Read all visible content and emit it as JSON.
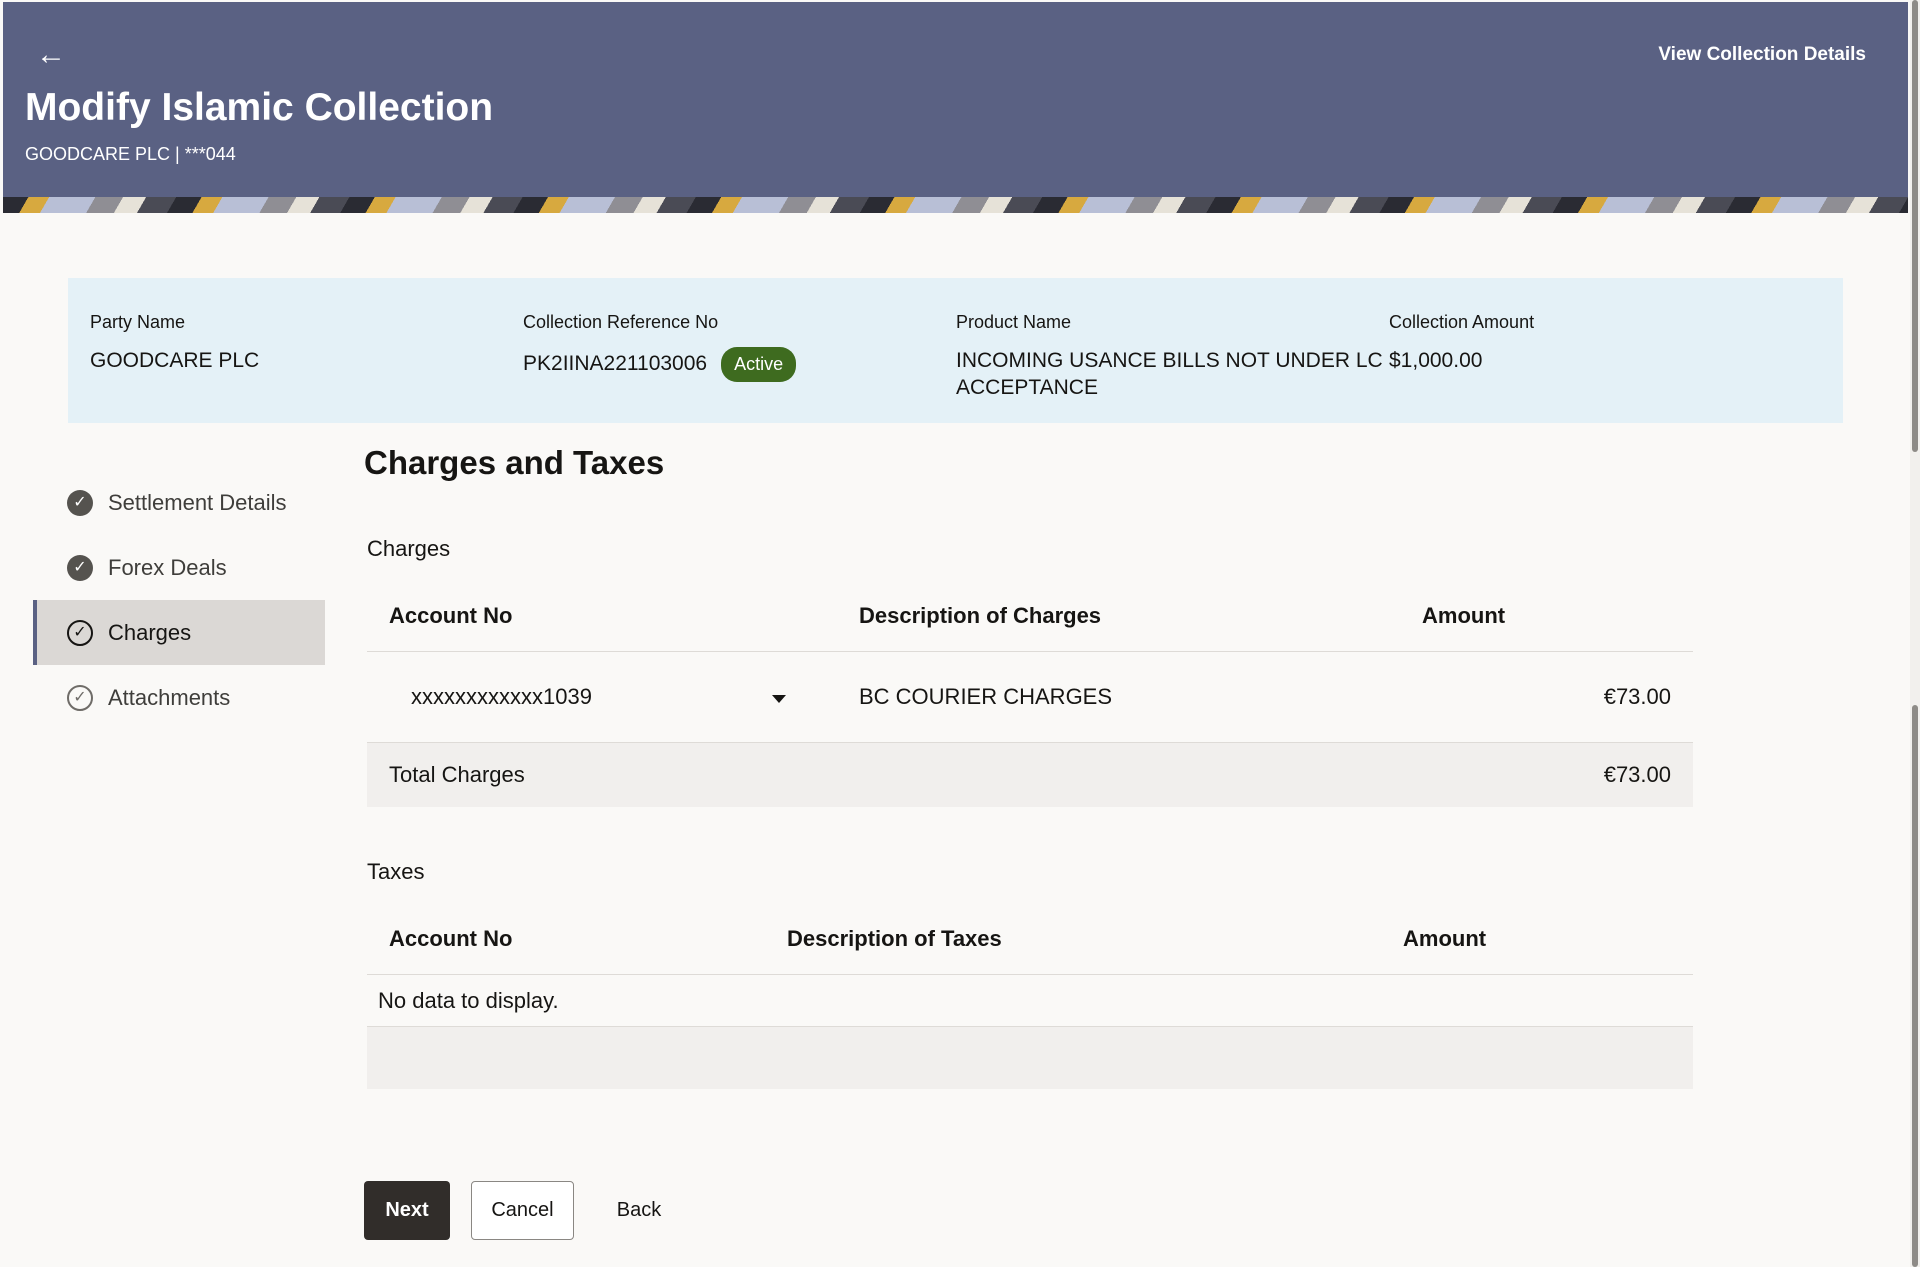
{
  "header": {
    "title": "Modify Islamic Collection",
    "subtitle": "GOODCARE PLC | ***044",
    "back_icon": "←",
    "view_link": "View Collection Details"
  },
  "summary": {
    "party_name_label": "Party Name",
    "party_name": "GOODCARE PLC",
    "ref_label": "Collection Reference No",
    "ref_value": "PK2IINA221103006",
    "status": "Active",
    "product_label": "Product Name",
    "product_line1": "INCOMING USANCE BILLS NOT UNDER LC",
    "product_line2": "ACCEPTANCE",
    "amount_label": "Collection Amount",
    "amount": "$1,000.00"
  },
  "nav": {
    "items": [
      {
        "label": "Settlement Details",
        "icon": "check-circle-filled-icon"
      },
      {
        "label": "Forex Deals",
        "icon": "check-circle-filled-icon"
      },
      {
        "label": "Charges",
        "icon": "check-circle-outline-icon",
        "active": true
      },
      {
        "label": "Attachments",
        "icon": "check-circle-outline-icon"
      }
    ]
  },
  "main": {
    "section_title": "Charges and Taxes",
    "charges": {
      "label": "Charges",
      "headers": [
        "Account No",
        "Description of Charges",
        "Amount"
      ],
      "rows": [
        {
          "account": "xxxxxxxxxxxx1039",
          "description": "BC COURIER CHARGES",
          "amount": "€73.00"
        }
      ],
      "total_label": "Total Charges",
      "total_amount": "€73.00"
    },
    "taxes": {
      "label": "Taxes",
      "headers": [
        "Account No",
        "Description of Taxes",
        "Amount"
      ],
      "empty_message": "No data to display."
    }
  },
  "actions": {
    "next": "Next",
    "cancel": "Cancel",
    "back": "Back"
  },
  "colors": {
    "header_bg": "#5a6183",
    "status_badge": "#3e6b1f",
    "summary_bg": "#e4f1f7",
    "primary_button": "#312d2a"
  }
}
